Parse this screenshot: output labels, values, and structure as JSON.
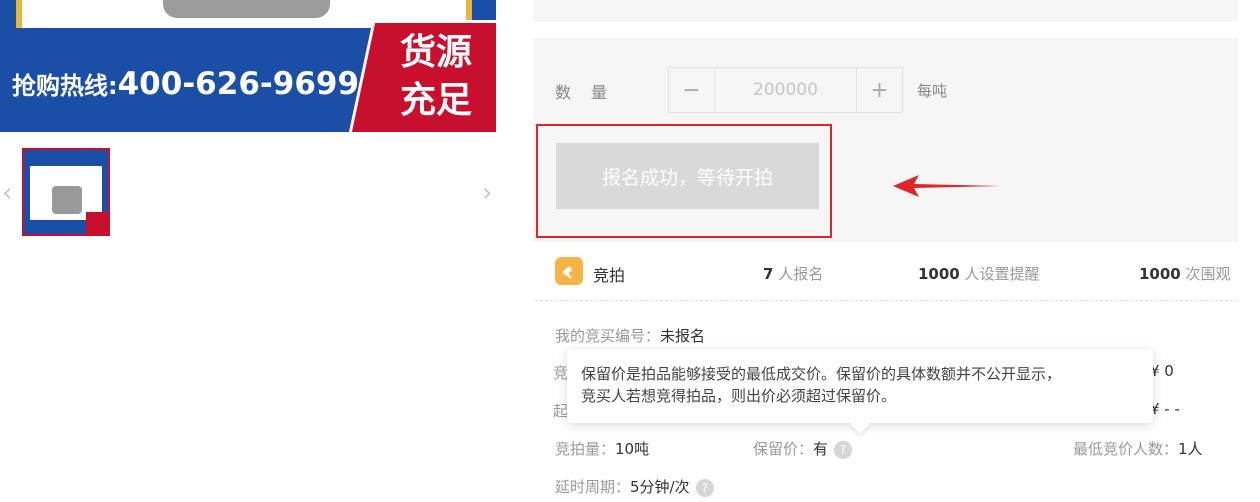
{
  "gallery": {
    "hotline_prefix": "抢购热线:",
    "hotline_number": "400-626-9699",
    "promo_line1": "货源",
    "promo_line2": "充足",
    "prev_arrow": "‹",
    "next_arrow": "›"
  },
  "purchase": {
    "qty_label": "数量",
    "qty_value": "200000",
    "minus": "−",
    "plus": "+",
    "unit": "每吨",
    "signup_button": "报名成功，等待开拍"
  },
  "auction": {
    "label": "竞拍",
    "signups_count": "7",
    "signups_text": "人报名",
    "reminders_count": "1000",
    "reminders_text": "人设置提醒",
    "views_count": "1000",
    "views_text": "次围观"
  },
  "details": {
    "bid_number_label": "我的竞买编号：",
    "bid_number_value": "未报名",
    "partial_label_1": "竞",
    "partial_label_2": "起",
    "price_right_1": "¥ 0",
    "price_right_2": "¥ - -",
    "quantity_label": "竞拍量：",
    "quantity_value": "10吨",
    "reserve_label": "保留价：",
    "reserve_value": "有",
    "min_bidders_label": "最低竞价人数：",
    "min_bidders_value": "1人",
    "delay_label": "延时周期：",
    "delay_value": "5分钟/次"
  },
  "tooltip": {
    "line1": "保留价是拍品能够接受的最低成交价。保留价的具体数额并不公开显示，",
    "line2": "竞买人若想竞得拍品，则出价必须超过保留价。"
  },
  "colors": {
    "banner_blue": "#1a4ea7",
    "promo_red": "#c8102e",
    "highlight_red": "#e0252a",
    "auction_orange": "#f7b345"
  },
  "icons": {
    "auction": "gavel-icon",
    "help": "question-circle-icon",
    "annotation": "red-arrow-icon"
  }
}
